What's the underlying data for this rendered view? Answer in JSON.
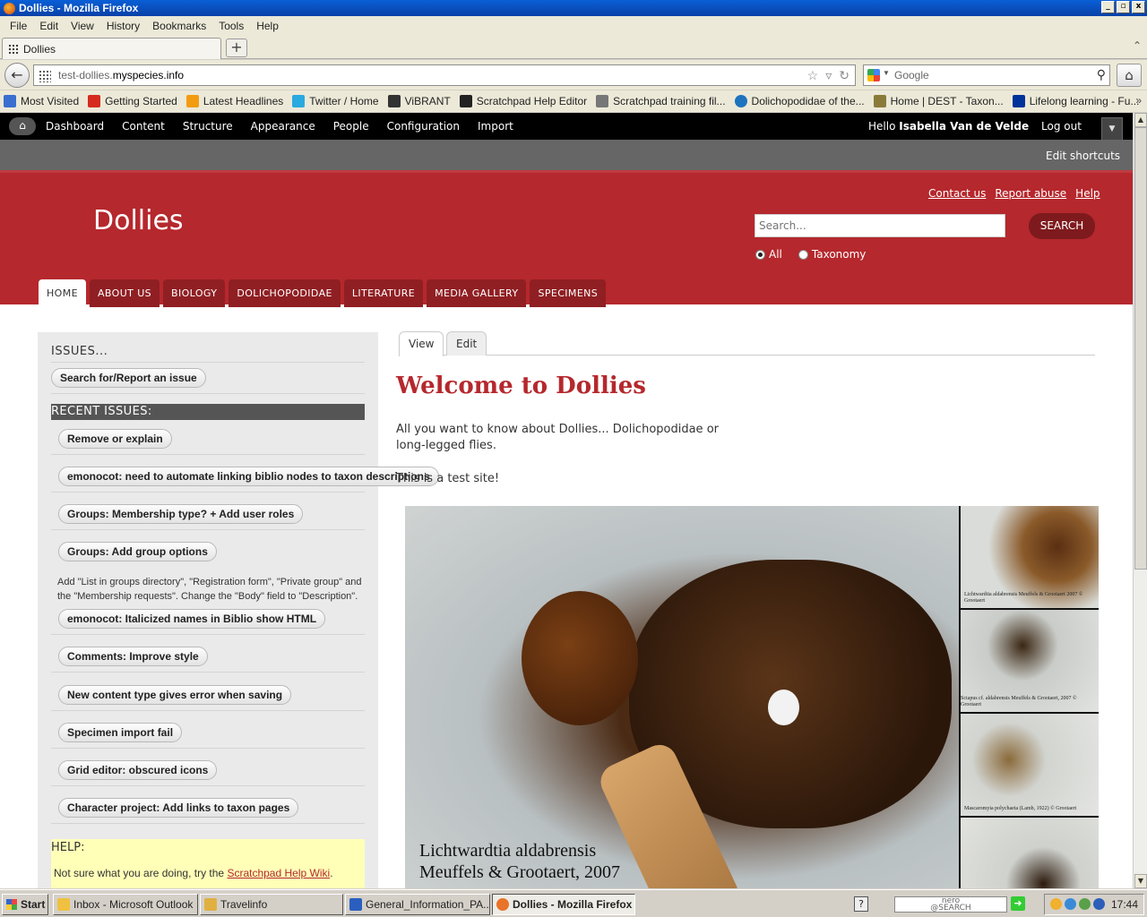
{
  "window": {
    "title": "Dollies - Mozilla Firefox",
    "controls": [
      "_",
      "▫",
      "x"
    ]
  },
  "menu": [
    "File",
    "Edit",
    "View",
    "History",
    "Bookmarks",
    "Tools",
    "Help"
  ],
  "tabs": [
    {
      "label": "Dollies"
    }
  ],
  "newtab_label": "+",
  "tab_scroll": "⌃",
  "nav": {
    "url_prefix": "test-dollies.",
    "url_host": "myspecies.info",
    "search_placeholder": "Google"
  },
  "bookmarks": [
    {
      "label": "Most Visited",
      "color": "#3a6fd0"
    },
    {
      "label": "Getting Started",
      "color": "#d52b1e"
    },
    {
      "label": "Latest Headlines",
      "color": "#f39c12"
    },
    {
      "label": "Twitter / Home",
      "color": "#2aa9e0"
    },
    {
      "label": "ViBRANT",
      "color": "#333333"
    },
    {
      "label": "Scratchpad Help Editor",
      "color": "#222222"
    },
    {
      "label": "Scratchpad training fil...",
      "color": "#777777"
    },
    {
      "label": "Dolichopodidae of the...",
      "color": "#1e73be"
    },
    {
      "label": "Home | DEST - Taxon...",
      "color": "#8a7a3a"
    },
    {
      "label": "Lifelong learning - Fu...",
      "color": "#003399"
    }
  ],
  "bookmarks_more": "»",
  "admin": {
    "menu": [
      "Dashboard",
      "Content",
      "Structure",
      "Appearance",
      "People",
      "Configuration",
      "Import"
    ],
    "hello": "Hello",
    "user": "Isabella Van de Velde",
    "logout": "Log out",
    "edit_shortcuts": "Edit shortcuts"
  },
  "site": {
    "name": "Dollies",
    "secondary_links": [
      "Contact us",
      "Report abuse",
      "Help"
    ],
    "search_placeholder": "Search...",
    "search_button": "SEARCH",
    "radios": [
      {
        "label": "All",
        "checked": true
      },
      {
        "label": "Taxonomy",
        "checked": false
      }
    ],
    "main_nav": [
      "HOME",
      "ABOUT US",
      "BIOLOGY",
      "DOLICHOPODIDAE",
      "LITERATURE",
      "MEDIA GALLERY",
      "SPECIMENS"
    ],
    "active_nav": "HOME"
  },
  "sidebar": {
    "issues_title": "ISSUES...",
    "search_issue_button": "Search for/Report an issue",
    "recent_title": "RECENT ISSUES:",
    "issues": [
      "Remove or explain",
      "emonocot: need to automate linking biblio nodes to taxon descriptions",
      "Groups: Membership type? + Add user roles",
      "Groups: Add group options",
      "emonocot: Italicized names in Biblio show HTML",
      "Comments: Improve style",
      "New content type gives error when saving",
      "Specimen import fail",
      "Grid editor: obscured icons",
      "Character project: Add links to taxon pages"
    ],
    "issue_description": "Add \"List in groups directory\", \"Registration form\", \"Private group\" and the \"Membership requests\". Change the \"Body\" field to \"Description\".",
    "help_title": "HELP:",
    "help_text": "Not sure what you are doing, try the",
    "help_link": "Scratchpad Help Wiki",
    "help_end": "."
  },
  "content": {
    "tabs": [
      "View",
      "Edit"
    ],
    "title": "Welcome to Dollies",
    "body1": "All you want to know about Dollies... Dolichopodidae or long-legged flies.",
    "body2": "This is a test site!",
    "hero_caption_line1": "Lichtwardtia aldabrensis",
    "hero_caption_line2": "Meuffels & Grootaert, 2007",
    "thumbs": [
      {
        "caption": "Lichtwardtia aldabrensis Meuffels & Grootaert 2007 © Grootaert"
      },
      {
        "caption": "Sciapus cf. aldabrensis Meuffels & Grootaert, 2007 © Grootaert"
      },
      {
        "caption": "Mascaromyia polychaeta (Lamb, 1922) © Grootaert"
      },
      {
        "caption": ""
      }
    ]
  },
  "taskbar": {
    "start": "Start",
    "tasks": [
      {
        "label": "Inbox - Microsoft Outlook",
        "color": "#f0c040"
      },
      {
        "label": "Travelinfo",
        "color": "#e0b040"
      },
      {
        "label": "General_Information_PA...",
        "color": "#2b5fbf"
      },
      {
        "label": "Dollies - Mozilla Firefox",
        "color": "#e8742a"
      }
    ],
    "nero_line1": "nero",
    "nero_line2": "@SEARCH",
    "clock": "17:44",
    "help": "?"
  }
}
